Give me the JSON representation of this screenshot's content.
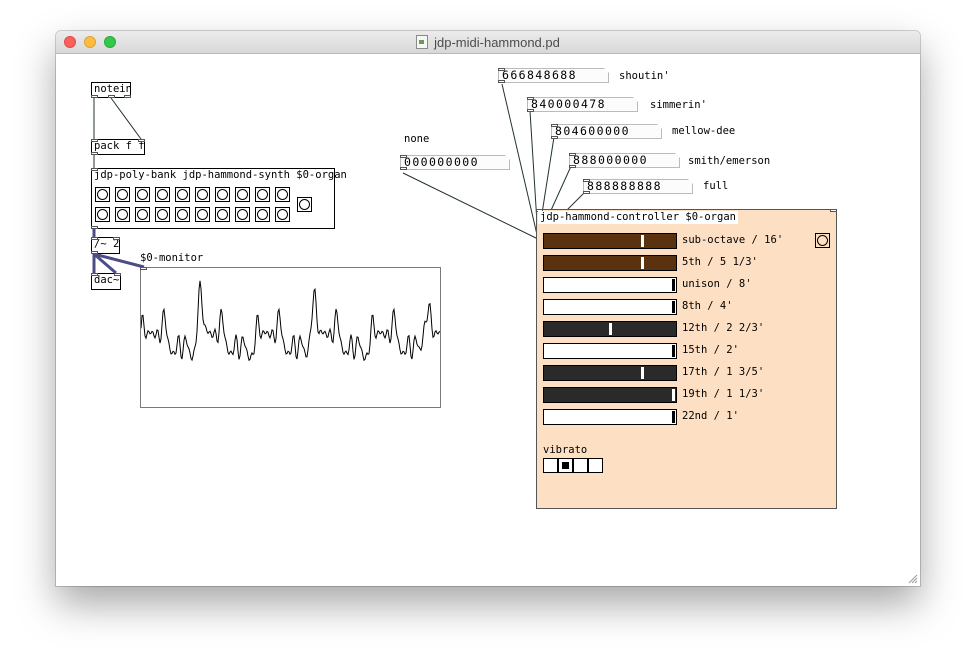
{
  "window": {
    "title": "jdp-midi-hammond.pd"
  },
  "objects": {
    "notein": "notein",
    "pack": "pack f f",
    "poly_bank": "jdp-poly-bank jdp-hammond-synth $0-organ",
    "divide": "/~ 2",
    "dac": "dac~",
    "monitor_label": "$0-monitor",
    "controller": "jdp-hammond-controller $0-organ"
  },
  "presets": [
    {
      "digits": "666848688",
      "label": "shoutin'"
    },
    {
      "digits": "840000478",
      "label": "simmerin'"
    },
    {
      "digits": "804600000",
      "label": "mellow-dee"
    },
    {
      "digits": "000000000",
      "label": "none"
    },
    {
      "digits": "888000000",
      "label": "smith/emerson"
    },
    {
      "digits": "888888888",
      "label": "full"
    }
  ],
  "drawbars": [
    {
      "label": "sub-octave / 16'",
      "value": 0.75,
      "color": "#5a3210"
    },
    {
      "label": "5th / 5 1/3'",
      "value": 0.75,
      "color": "#5a3210"
    },
    {
      "label": "unison / 8'",
      "value": 1.0,
      "color": "#ffffff"
    },
    {
      "label": "8th / 4'",
      "value": 1.0,
      "color": "#ffffff"
    },
    {
      "label": "12th / 2 2/3'",
      "value": 0.5,
      "color": "#2a2a2a"
    },
    {
      "label": "15th / 2'",
      "value": 1.0,
      "color": "#ffffff"
    },
    {
      "label": "17th / 1 3/5'",
      "value": 0.75,
      "color": "#2a2a2a"
    },
    {
      "label": "19th / 1 1/3'",
      "value": 1.0,
      "color": "#2a2a2a"
    },
    {
      "label": "22nd / 1'",
      "value": 1.0,
      "color": "#ffffff"
    }
  ],
  "vibrato": {
    "label": "vibrato",
    "options": 4,
    "selected": 1
  },
  "colors": {
    "controller_bg": "#fde0c4",
    "patch_cord": "#23352a",
    "signal_cord": "#4a4d86"
  }
}
